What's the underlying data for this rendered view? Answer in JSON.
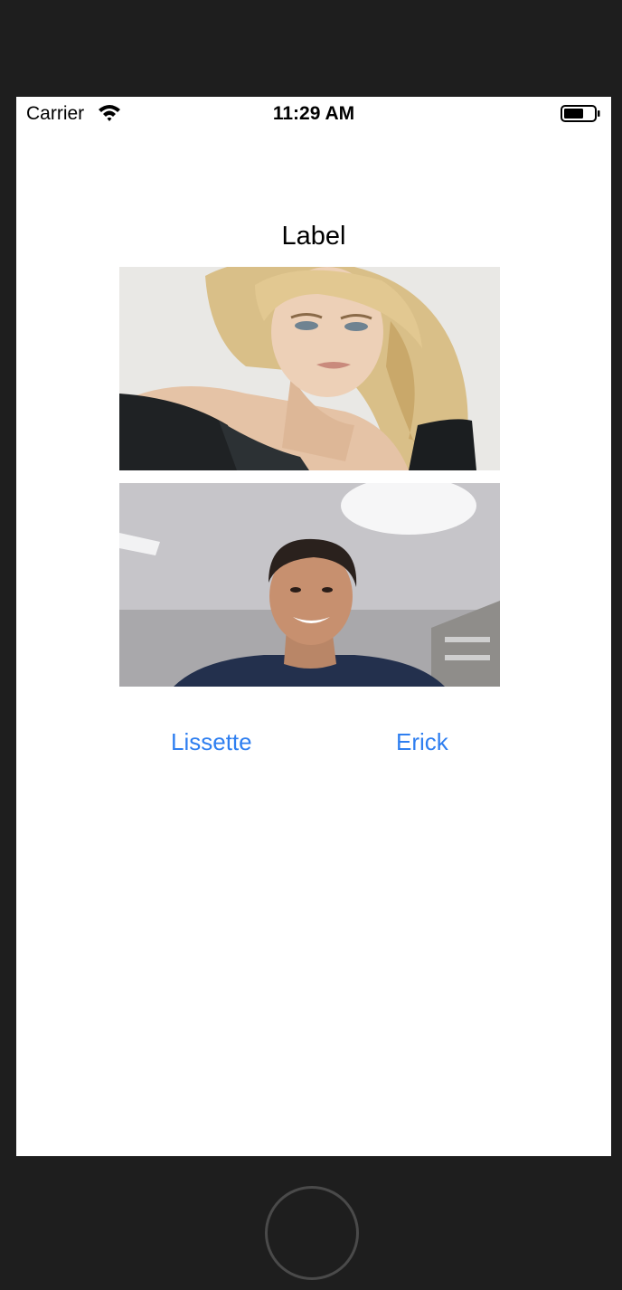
{
  "status_bar": {
    "carrier": "Carrier",
    "time": "11:29 AM",
    "icons": [
      "wifi-icon",
      "battery-icon"
    ]
  },
  "main": {
    "title_label": "Label",
    "images": [
      {
        "name": "photo-woman",
        "description_icon": "portrait-photo"
      },
      {
        "name": "photo-man",
        "description_icon": "portrait-photo"
      }
    ],
    "buttons": {
      "lissette": "Lissette",
      "erick": "Erick"
    }
  },
  "colors": {
    "device_frame": "#1e1e1e",
    "screen_background": "#ffffff",
    "button_tint": "#2f7ff0",
    "home_button_ring": "#4a4a4a"
  }
}
